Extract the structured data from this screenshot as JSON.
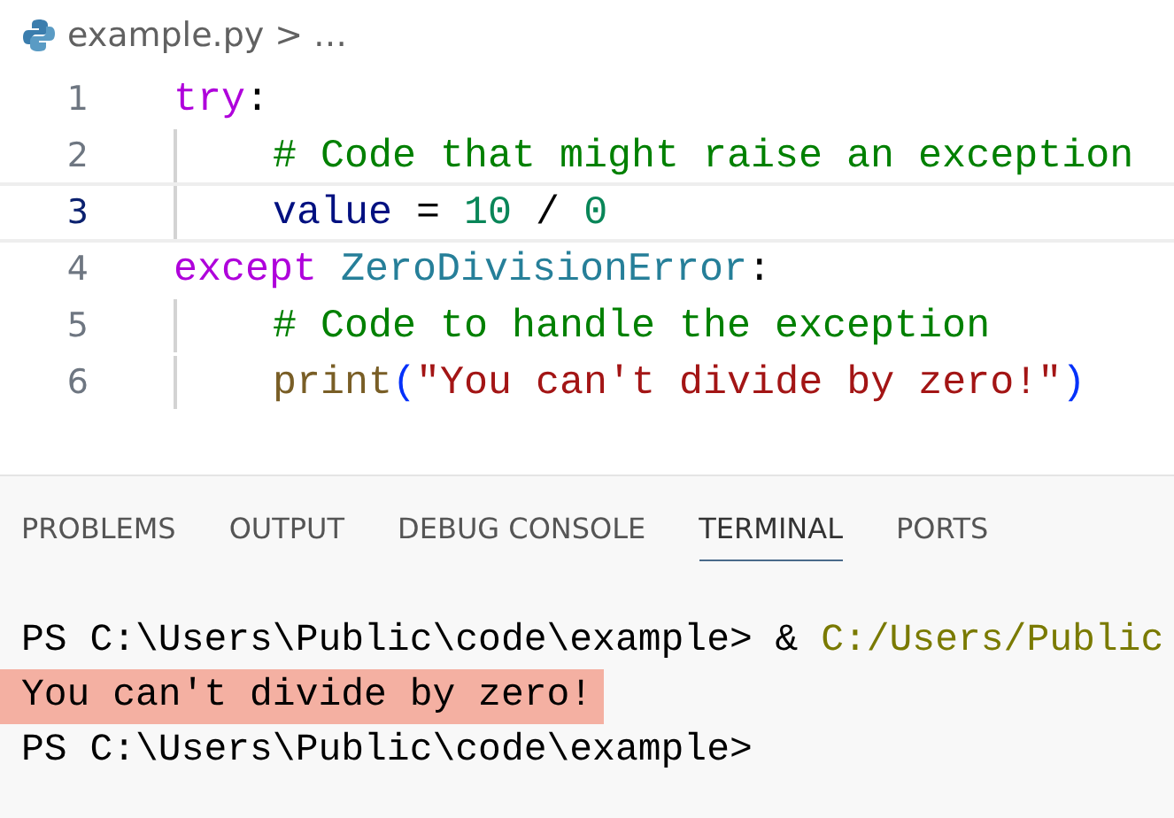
{
  "breadcrumb": {
    "file": "example.py",
    "separator": ">",
    "more": "…"
  },
  "editor": {
    "lines": [
      {
        "number": "1",
        "current": false,
        "indent": false,
        "tokens": [
          {
            "kind": "keyword",
            "text": "try"
          },
          {
            "kind": "plain",
            "text": ":"
          }
        ]
      },
      {
        "number": "2",
        "current": false,
        "indent": true,
        "tokens": [
          {
            "kind": "comment",
            "text": "# Code that might raise an exception"
          }
        ]
      },
      {
        "number": "3",
        "current": true,
        "indent": true,
        "tokens": [
          {
            "kind": "variable",
            "text": "value"
          },
          {
            "kind": "plain",
            "text": " = "
          },
          {
            "kind": "number",
            "text": "10"
          },
          {
            "kind": "plain",
            "text": " / "
          },
          {
            "kind": "number",
            "text": "0"
          }
        ]
      },
      {
        "number": "4",
        "current": false,
        "indent": false,
        "tokens": [
          {
            "kind": "keyword",
            "text": "except "
          },
          {
            "kind": "class",
            "text": "ZeroDivisionError"
          },
          {
            "kind": "plain",
            "text": ":"
          }
        ]
      },
      {
        "number": "5",
        "current": false,
        "indent": true,
        "tokens": [
          {
            "kind": "comment",
            "text": "# Code to handle the exception"
          }
        ]
      },
      {
        "number": "6",
        "current": false,
        "indent": true,
        "tokens": [
          {
            "kind": "function",
            "text": "print"
          },
          {
            "kind": "bracket",
            "text": "("
          },
          {
            "kind": "string",
            "text": "\"You can't divide by zero!\""
          },
          {
            "kind": "bracket",
            "text": ")"
          }
        ]
      }
    ]
  },
  "panel_tabs": [
    {
      "label": "PROBLEMS",
      "selected": false
    },
    {
      "label": "OUTPUT",
      "selected": false
    },
    {
      "label": "DEBUG CONSOLE",
      "selected": false
    },
    {
      "label": "TERMINAL",
      "selected": true
    },
    {
      "label": "PORTS",
      "selected": false
    }
  ],
  "terminal": {
    "lines": [
      {
        "highlighted": false,
        "segments": [
          {
            "kind": "plain",
            "text": "PS C:\\Users\\Public\\code\\example> & "
          },
          {
            "kind": "path",
            "text": "C:/Users/Public"
          }
        ]
      },
      {
        "highlighted": true,
        "segments": [
          {
            "kind": "plain",
            "text": "You can't divide by zero!"
          }
        ]
      },
      {
        "highlighted": false,
        "segments": [
          {
            "kind": "plain",
            "text": "PS C:\\Users\\Public\\code\\example>"
          }
        ]
      }
    ]
  }
}
